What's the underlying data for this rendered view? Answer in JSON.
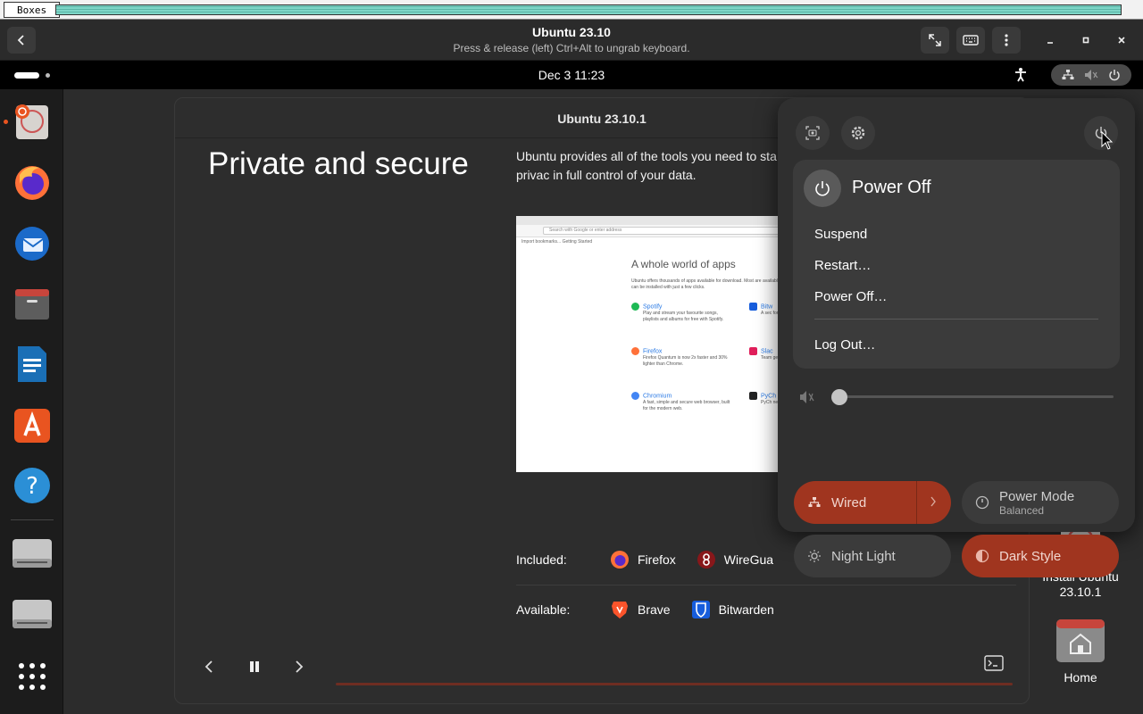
{
  "x11": {
    "title": "Boxes"
  },
  "header": {
    "title": "Ubuntu 23.10",
    "subtitle": "Press & release (left) Ctrl+Alt to ungrab keyboard."
  },
  "topbar": {
    "clock": "Dec 3  11:23"
  },
  "dock": {
    "items": [
      "ubuntu-installer",
      "firefox",
      "thunderbird",
      "files",
      "libreoffice-writer",
      "app-center",
      "help",
      "drive",
      "drive",
      "show-apps"
    ]
  },
  "installer": {
    "window_title": "Ubuntu 23.10.1",
    "heading": "Private and secure",
    "description": "Ubuntu provides all of the tools you need to sta in firewall and VPN support and a host of privac in full control of your data.",
    "screenshot": {
      "url_placeholder": "Search with Google or enter address",
      "bookmarks": "Import bookmarks...   Getting Started",
      "headline": "A whole world of apps",
      "subline": "Ubuntu offers thousands of apps available for download. Most are available for free and can be installed with just a few clicks.",
      "apps": [
        {
          "name": "Spotify",
          "desc": "Play and stream your favourite songs, playlists and albums for free with Spotify."
        },
        {
          "name": "Firefox",
          "desc": "Firefox Quantum is now 2x faster and 30% lighter than Chrome."
        },
        {
          "name": "Chromium",
          "desc": "A fast, simple and secure web browser, built for the modern web."
        },
        {
          "name": "Bitw",
          "desc": "A sec for al"
        },
        {
          "name": "Slac",
          "desc": "Team get m"
        },
        {
          "name": "PyCh",
          "desc": "PyCh need"
        }
      ]
    },
    "included_label": "Included:",
    "included": [
      "Firefox",
      "WireGua"
    ],
    "available_label": "Available:",
    "available": [
      "Brave",
      "Bitwarden"
    ],
    "progress": 0
  },
  "quick_settings": {
    "power_menu": {
      "title": "Power Off",
      "items": [
        "Suspend",
        "Restart…",
        "Power Off…",
        "Log Out…"
      ]
    },
    "volume_level": 0,
    "tiles": {
      "wired": {
        "label": "Wired",
        "active": true
      },
      "power_mode": {
        "label": "Power Mode",
        "sub": "Balanced",
        "active": false
      },
      "night_light": {
        "label": "Night Light",
        "active": false
      },
      "dark_style": {
        "label": "Dark Style",
        "active": true
      }
    }
  },
  "desktop": {
    "install": "Install Ubuntu 23.10.1",
    "home": "Home"
  },
  "colors": {
    "accent": "#a0351f",
    "panel": "#2f2f2f",
    "dock": "#1c1c1c"
  }
}
